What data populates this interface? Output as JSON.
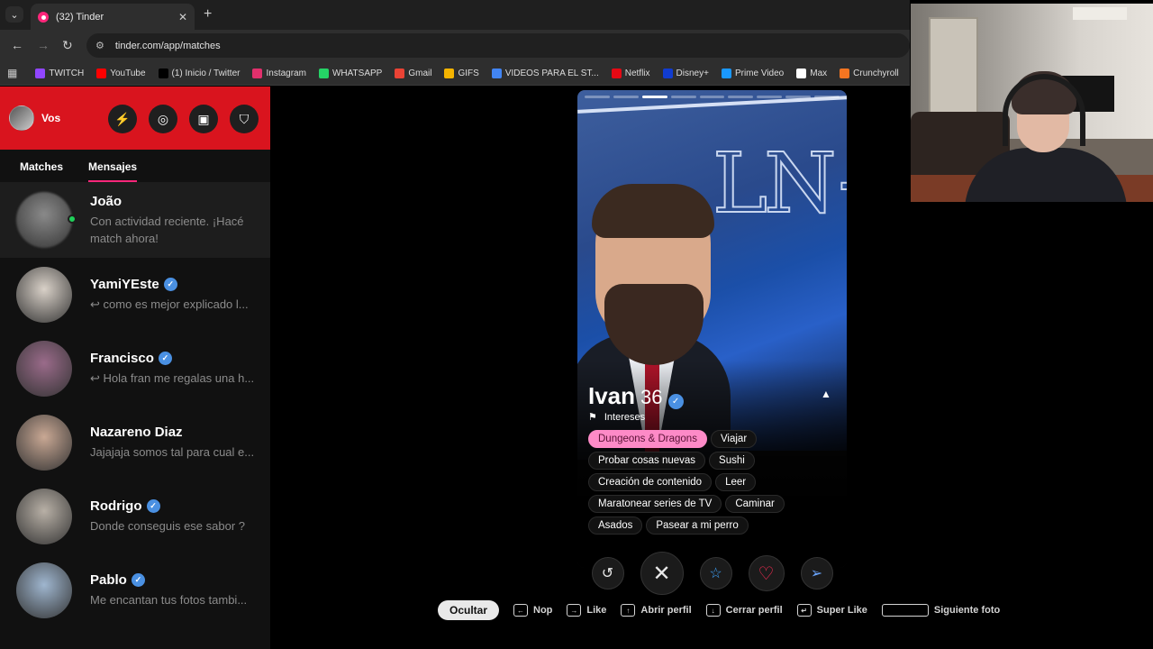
{
  "browser": {
    "tab_title": "(32) Tinder",
    "url": "tinder.com/app/matches",
    "bookmarks": [
      {
        "label": "TWITCH",
        "color": "#9146ff"
      },
      {
        "label": "YouTube",
        "color": "#ff0000"
      },
      {
        "label": "(1) Inicio / Twitter",
        "color": "#000000"
      },
      {
        "label": "Instagram",
        "color": "#e1306c"
      },
      {
        "label": "WHATSAPP",
        "color": "#25d366"
      },
      {
        "label": "Gmail",
        "color": "#ea4335"
      },
      {
        "label": "GIFS",
        "color": "#f5b400"
      },
      {
        "label": "VIDEOS PARA EL ST...",
        "color": "#4285f4"
      },
      {
        "label": "Netflix",
        "color": "#e50914"
      },
      {
        "label": "Disney+",
        "color": "#113ccf"
      },
      {
        "label": "Prime Video",
        "color": "#1a98ff"
      },
      {
        "label": "Max",
        "color": "#ffffff"
      },
      {
        "label": "Crunchyroll",
        "color": "#f47521"
      }
    ]
  },
  "sidebar": {
    "user_name": "Vos",
    "tabs": {
      "matches": "Matches",
      "messages": "Mensajes"
    },
    "messages": [
      {
        "name": "João",
        "preview": "Con actividad reciente. ¡Hacé match ahora!",
        "verified": false,
        "online": true,
        "avatar_color": "#8a8a8a"
      },
      {
        "name": "YamiYEste",
        "preview": "↩ como es mejor explicado l...",
        "verified": true,
        "online": false,
        "avatar_color": "#d9d1c8"
      },
      {
        "name": "Francisco",
        "preview": "↩ Hola fran me regalas una h...",
        "verified": true,
        "online": false,
        "avatar_color": "#9a6b8a"
      },
      {
        "name": "Nazareno Diaz",
        "preview": "Jajajaja somos tal para cual e...",
        "verified": false,
        "online": false,
        "avatar_color": "#c9a894"
      },
      {
        "name": "Rodrigo",
        "preview": "Donde conseguis ese sabor ?",
        "verified": true,
        "online": false,
        "avatar_color": "#b8b0a6"
      },
      {
        "name": "Pablo",
        "preview": "Me encantan tus fotos tambi...",
        "verified": true,
        "online": false,
        "avatar_color": "#9fb6cf"
      }
    ]
  },
  "profile": {
    "name": "Ivan",
    "age": "36",
    "interests_label": "Intereses",
    "photo_count": 9,
    "active_photo": 3,
    "interests": [
      {
        "label": "Dungeons & Dragons",
        "highlight": true
      },
      {
        "label": "Viajar",
        "highlight": false
      },
      {
        "label": "Probar cosas nuevas",
        "highlight": false
      },
      {
        "label": "Sushi",
        "highlight": false
      },
      {
        "label": "Creación de contenido",
        "highlight": false
      },
      {
        "label": "Leer",
        "highlight": false
      },
      {
        "label": "Maratonear series de TV",
        "highlight": false
      },
      {
        "label": "Caminar",
        "highlight": false
      },
      {
        "label": "Asados",
        "highlight": false
      },
      {
        "label": "Pasear a mi perro",
        "highlight": false
      }
    ]
  },
  "actions": {
    "rewind_icon": "rewind-icon",
    "nope_icon": "close-icon",
    "superlike_icon": "star-icon",
    "like_icon": "heart-icon",
    "boost_icon": "send-icon"
  },
  "hints": {
    "hide": "Ocultar",
    "nope": "Nop",
    "like": "Like",
    "open": "Abrir perfil",
    "close": "Cerrar perfil",
    "superlike": "Super Like",
    "next_photo": "Siguiente foto"
  },
  "colors": {
    "brand_red": "#d9141e",
    "accent_pink": "#fd267a",
    "chip_highlight": "#fd8ac7",
    "verified_blue": "#4a90e2"
  }
}
